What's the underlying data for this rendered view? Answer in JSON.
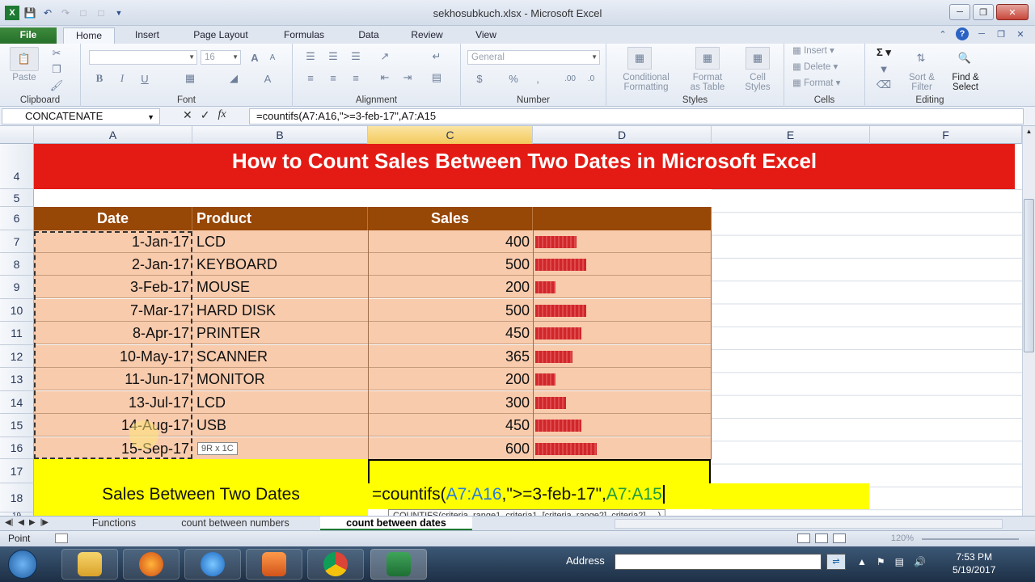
{
  "window": {
    "title": "sekhosubkuch.xlsx - Microsoft Excel",
    "quick_access": [
      "save-icon",
      "undo-icon",
      "redo-icon",
      "new-icon",
      "open-icon"
    ]
  },
  "ribbon_tabs": [
    "File",
    "Home",
    "Insert",
    "Page Layout",
    "Formulas",
    "Data",
    "Review",
    "View"
  ],
  "ribbon": {
    "clipboard": {
      "label": "Clipboard",
      "paste": "Paste"
    },
    "font": {
      "label": "Font",
      "size": "16"
    },
    "alignment": {
      "label": "Alignment"
    },
    "number": {
      "label": "Number",
      "format": "General",
      "currency": "$",
      "percent": "%"
    },
    "styles": {
      "label": "Styles",
      "conditional": "Conditional\nFormatting",
      "format_table": "Format\nas Table",
      "cell_styles": "Cell\nStyles"
    },
    "cells": {
      "label": "Cells",
      "insert": "Insert",
      "delete": "Delete",
      "format": "Format"
    },
    "editing": {
      "label": "Editing",
      "sort": "Sort &\nFilter",
      "find": "Find &\nSelect"
    }
  },
  "formula_bar": {
    "name_box": "CONCATENATE",
    "fx": "fx",
    "formula": "=countifs(A7:A16,\">=3-feb-17\",A7:A15"
  },
  "columns": [
    "A",
    "B",
    "C",
    "D",
    "E",
    "F"
  ],
  "rows": [
    "4",
    "5",
    "6",
    "7",
    "8",
    "9",
    "10",
    "11",
    "12",
    "13",
    "14",
    "15",
    "16",
    "17",
    "18",
    "19"
  ],
  "sheet": {
    "banner": "How to Count Sales Between Two Dates in Microsoft Excel",
    "headers": {
      "date": "Date",
      "product": "Product",
      "sales": "Sales"
    },
    "records": [
      {
        "date": "1-Jan-17",
        "product": "LCD",
        "sales": "400",
        "bar": 400
      },
      {
        "date": "2-Jan-17",
        "product": "KEYBOARD",
        "sales": "500",
        "bar": 500
      },
      {
        "date": "3-Feb-17",
        "product": "MOUSE",
        "sales": "200",
        "bar": 200
      },
      {
        "date": "7-Mar-17",
        "product": "HARD DISK",
        "sales": "500",
        "bar": 500
      },
      {
        "date": "8-Apr-17",
        "product": "PRINTER",
        "sales": "450",
        "bar": 450
      },
      {
        "date": "10-May-17",
        "product": "SCANNER",
        "sales": "365",
        "bar": 365
      },
      {
        "date": "11-Jun-17",
        "product": "MONITOR",
        "sales": "200",
        "bar": 200
      },
      {
        "date": "13-Jul-17",
        "product": "LCD",
        "sales": "300",
        "bar": 300
      },
      {
        "date": "14-Aug-17",
        "product": "USB",
        "sales": "450",
        "bar": 450
      },
      {
        "date": "15-Sep-17",
        "product": "",
        "sales": "600",
        "bar": 600
      }
    ],
    "bar_max": 600,
    "summary_label": "Sales Between Two Dates",
    "edit_parts": {
      "a": "=countifs(",
      "b": "A7:A16",
      "c": ",\">=3-feb-17\",",
      "d": "A7:A15"
    },
    "function_tooltip": "COUNTIFS(criteria_range1, criteria1, [criteria_range2], criteria2], ...)",
    "size_tip": "9R x 1C"
  },
  "sheet_tabs": [
    "Functions",
    "count between numbers",
    "count between dates"
  ],
  "status": {
    "mode": "Point",
    "zoom": "120%"
  },
  "taskbar": {
    "address_label": "Address",
    "time": "7:53 PM",
    "date": "5/19/2017"
  }
}
